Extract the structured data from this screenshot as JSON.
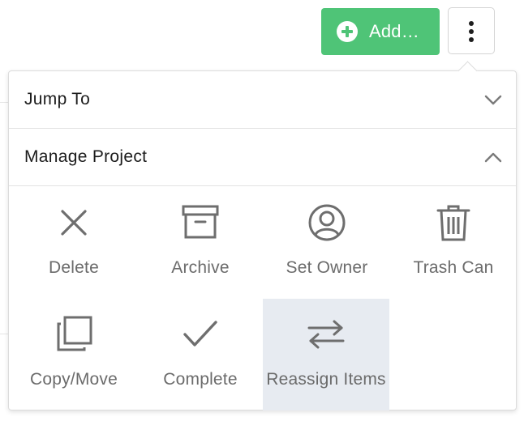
{
  "toolbar": {
    "add_label": "Add…",
    "add_icon": "plus-circle-icon",
    "more_icon": "vertical-ellipsis-icon",
    "accent_color": "#4fc477"
  },
  "menu": {
    "sections": [
      {
        "title": "Jump To",
        "state": "collapsed",
        "icon": "chevron-down-icon"
      },
      {
        "title": "Manage Project",
        "state": "expanded",
        "icon": "chevron-up-icon"
      }
    ],
    "actions": [
      {
        "label": "Delete",
        "icon": "close-x-icon"
      },
      {
        "label": "Archive",
        "icon": "archive-box-icon"
      },
      {
        "label": "Set Owner",
        "icon": "user-circle-icon"
      },
      {
        "label": "Trash Can",
        "icon": "trash-can-icon"
      },
      {
        "label": "Copy/Move",
        "icon": "copy-icon"
      },
      {
        "label": "Complete",
        "icon": "checkmark-icon"
      },
      {
        "label": "Reassign Items",
        "icon": "swap-arrows-icon",
        "hovered": true
      }
    ]
  }
}
